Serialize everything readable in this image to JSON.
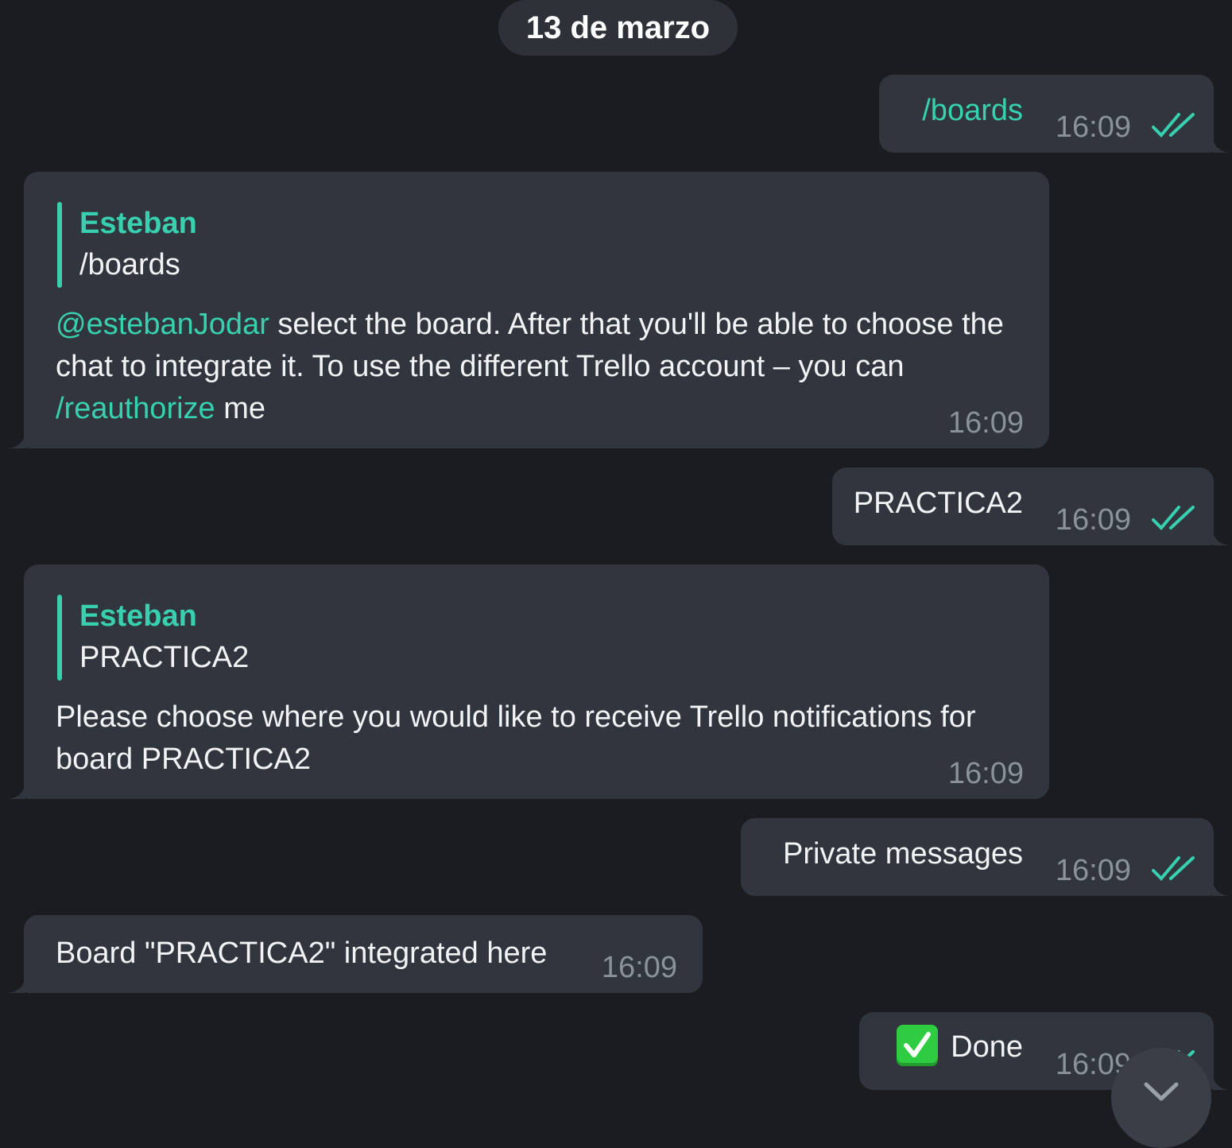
{
  "date_label": "13 de marzo",
  "colors": {
    "accent": "#38d1b0",
    "bubble": "#31353d",
    "background": "#1a1c20"
  },
  "messages": [
    {
      "direction": "out",
      "text": "/boards",
      "time": "16:09",
      "status": "read"
    },
    {
      "direction": "in",
      "reply_to": {
        "author": "Esteban",
        "text": "/boards"
      },
      "mention": "@estebanJodar",
      "text_part1": " select the board. After that you'll be able to choose the chat to integrate it. To use the different Trello account – you can ",
      "command": "/reauthorize",
      "text_part2": " me",
      "time": "16:09"
    },
    {
      "direction": "out",
      "text": "PRACTICA2",
      "time": "16:09",
      "status": "read"
    },
    {
      "direction": "in",
      "reply_to": {
        "author": "Esteban",
        "text": "PRACTICA2"
      },
      "text": "Please choose where you would like to receive Trello notifications for board PRACTICA2",
      "time": "16:09"
    },
    {
      "direction": "out",
      "text": "Private messages",
      "time": "16:09",
      "status": "read"
    },
    {
      "direction": "in",
      "text": "Board \"PRACTICA2\" integrated here",
      "time": "16:09"
    },
    {
      "direction": "out",
      "emoji": "check-mark-button-emoji",
      "text": "Done",
      "time": "16:09",
      "status": "read"
    }
  ],
  "scroll_button_icon": "chevron-down-icon"
}
